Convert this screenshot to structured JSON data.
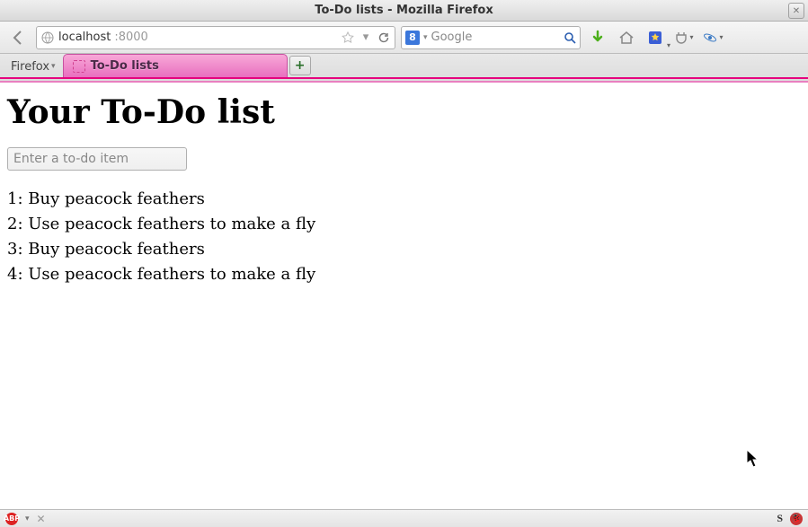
{
  "window": {
    "title": "To-Do lists - Mozilla Firefox"
  },
  "navbar": {
    "url_host": "localhost",
    "url_port": ":8000",
    "search_engine_badge": "8",
    "search_placeholder": "Google"
  },
  "tabstrip": {
    "firefox_menu_label": "Firefox",
    "tab_label": "To-Do lists",
    "newtab_label": "+"
  },
  "page": {
    "heading": "Your To-Do list",
    "input_placeholder": "Enter a to-do item",
    "items": [
      {
        "n": "1",
        "text": "Buy peacock feathers"
      },
      {
        "n": "2",
        "text": "Use peacock feathers to make a fly"
      },
      {
        "n": "3",
        "text": "Buy peacock feathers"
      },
      {
        "n": "4",
        "text": "Use peacock feathers to make a fly"
      }
    ]
  },
  "statusbar": {
    "abp_label": "ABP",
    "s_label": "S"
  }
}
